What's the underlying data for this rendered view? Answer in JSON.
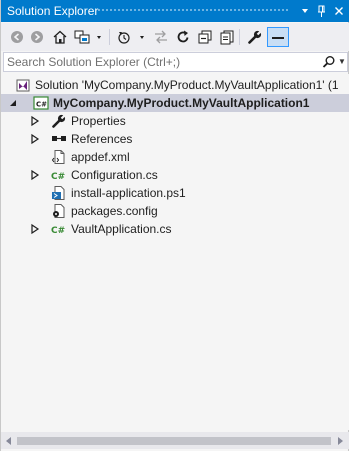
{
  "window": {
    "title": "Solution Explorer",
    "accent_color": "#007acc"
  },
  "titlebar_buttons": {
    "dropdown": "▾",
    "pin": "ᵖ",
    "close": "✕"
  },
  "toolbar": {
    "tools": [
      {
        "name": "back-icon",
        "enabled": false
      },
      {
        "name": "forward-icon",
        "enabled": false
      },
      {
        "name": "home-icon",
        "enabled": true
      },
      {
        "name": "switch-views-icon",
        "enabled": true
      },
      {
        "name": "pending-changes-filter-icon",
        "enabled": true
      },
      {
        "name": "sync-with-active-document-icon",
        "enabled": false
      },
      {
        "name": "refresh-icon",
        "enabled": true
      },
      {
        "name": "collapse-all-icon",
        "enabled": true
      },
      {
        "name": "show-all-files-icon",
        "enabled": true
      },
      {
        "name": "properties-wrench-icon",
        "enabled": true
      },
      {
        "name": "preview-selected-items-icon",
        "enabled": true,
        "active": true
      }
    ]
  },
  "search": {
    "placeholder": "Search Solution Explorer (Ctrl+;)",
    "value": ""
  },
  "tree": {
    "solution_label": "Solution 'MyCompany.MyProduct.MyVaultApplication1' (1",
    "project_label": "MyCompany.MyProduct.MyVaultApplication1",
    "items": [
      {
        "label": "Properties",
        "icon": "wrench-icon",
        "expandable": true
      },
      {
        "label": "References",
        "icon": "references-icon",
        "expandable": true
      },
      {
        "label": "appdef.xml",
        "icon": "xml-file-icon",
        "expandable": false
      },
      {
        "label": "Configuration.cs",
        "icon": "csharp-file-icon",
        "expandable": true
      },
      {
        "label": "install-application.ps1",
        "icon": "powershell-file-icon",
        "expandable": false
      },
      {
        "label": "packages.config",
        "icon": "config-file-icon",
        "expandable": false
      },
      {
        "label": "VaultApplication.cs",
        "icon": "csharp-file-icon",
        "expandable": true
      }
    ]
  },
  "colors": {
    "selection": "#cccedb",
    "csharp_green": "#388a34",
    "background": "#f5f5f5"
  }
}
